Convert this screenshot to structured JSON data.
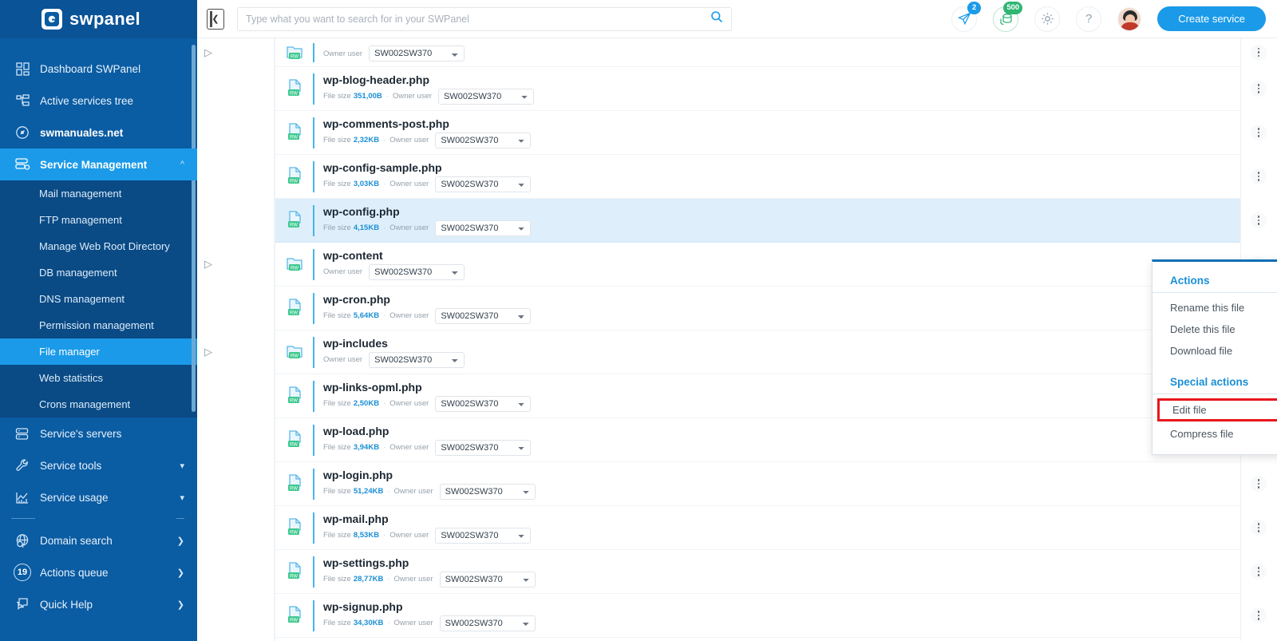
{
  "brand": {
    "name": "swpanel",
    "logo_icon": "swpanel-logo-icon"
  },
  "sidebar": {
    "items": [
      {
        "label": "Dashboard SWPanel",
        "icon": "grid-icon",
        "state": "normal",
        "chevron": ""
      },
      {
        "label": "Active services tree",
        "icon": "tree-icon",
        "state": "normal",
        "chevron": ""
      },
      {
        "label": "swmanuales.net",
        "icon": "domain-icon",
        "state": "bold",
        "chevron": ""
      },
      {
        "label": "Service Management",
        "icon": "server-gear-icon",
        "state": "active",
        "chevron": "chevron-up-icon"
      }
    ],
    "submenu": [
      {
        "label": "Mail management",
        "state": "normal"
      },
      {
        "label": "FTP management",
        "state": "normal"
      },
      {
        "label": "Manage Web Root Directory",
        "state": "normal"
      },
      {
        "label": "DB management",
        "state": "normal"
      },
      {
        "label": "DNS management",
        "state": "normal"
      },
      {
        "label": "Permission management",
        "state": "normal"
      },
      {
        "label": "File manager",
        "state": "active"
      },
      {
        "label": "Web statistics",
        "state": "normal"
      },
      {
        "label": "Crons management",
        "state": "normal"
      }
    ],
    "items_lower": [
      {
        "label": "Service's servers",
        "icon": "servers-icon",
        "chevron": ""
      },
      {
        "label": "Service tools",
        "icon": "wrench-icon",
        "chevron": "chevron-down-icon"
      },
      {
        "label": "Service usage",
        "icon": "chart-icon",
        "chevron": "chevron-down-icon"
      }
    ],
    "items_bottom": [
      {
        "label": "Domain search",
        "icon": "globe-search-icon",
        "badge": "",
        "chevron": "chevron-right-icon"
      },
      {
        "label": "Actions queue",
        "icon": "queue-count-icon",
        "badge": "19",
        "chevron": "chevron-right-icon"
      },
      {
        "label": "Quick Help",
        "icon": "chat-help-icon",
        "badge": "",
        "chevron": "chevron-right-icon"
      }
    ]
  },
  "topbar": {
    "collapse_icon": "collapse-panel-icon",
    "search": {
      "placeholder": "Type what you want to search for in your SWPanel",
      "value": ""
    },
    "search_icon": "search-icon",
    "icons": [
      {
        "name": "paper-plane-icon",
        "badge": "2",
        "badge_color": "#1a9ae8"
      },
      {
        "name": "database-icon",
        "badge": "500",
        "badge_color": "#2fb673"
      },
      {
        "name": "gear-icon",
        "badge": ""
      },
      {
        "name": "help-question-icon",
        "badge": ""
      }
    ],
    "avatar": "user-avatar",
    "create_button": "Create service"
  },
  "filelist": {
    "meta_size_label": "File size",
    "meta_owner_label": "Owner user",
    "owner_value": "SW002SW370",
    "owner_options": [
      "SW002SW370"
    ],
    "rows": [
      {
        "name": "",
        "type": "folder",
        "size": "",
        "owner": "SW002SW370",
        "expandable": true,
        "selected": false,
        "partial": true
      },
      {
        "name": "wp-blog-header.php",
        "type": "file",
        "size": "351,00B",
        "owner": "SW002SW370",
        "expandable": false,
        "selected": false
      },
      {
        "name": "wp-comments-post.php",
        "type": "file",
        "size": "2,32KB",
        "owner": "SW002SW370",
        "expandable": false,
        "selected": false
      },
      {
        "name": "wp-config-sample.php",
        "type": "file",
        "size": "3,03KB",
        "owner": "SW002SW370",
        "expandable": false,
        "selected": false
      },
      {
        "name": "wp-config.php",
        "type": "file",
        "size": "4,15KB",
        "owner": "SW002SW370",
        "expandable": false,
        "selected": true
      },
      {
        "name": "wp-content",
        "type": "folder",
        "size": "",
        "owner": "SW002SW370",
        "expandable": true,
        "selected": false
      },
      {
        "name": "wp-cron.php",
        "type": "file",
        "size": "5,64KB",
        "owner": "SW002SW370",
        "expandable": false,
        "selected": false
      },
      {
        "name": "wp-includes",
        "type": "folder",
        "size": "",
        "owner": "SW002SW370",
        "expandable": true,
        "selected": false
      },
      {
        "name": "wp-links-opml.php",
        "type": "file",
        "size": "2,50KB",
        "owner": "SW002SW370",
        "expandable": false,
        "selected": false
      },
      {
        "name": "wp-load.php",
        "type": "file",
        "size": "3,94KB",
        "owner": "SW002SW370",
        "expandable": false,
        "selected": false
      },
      {
        "name": "wp-login.php",
        "type": "file",
        "size": "51,24KB",
        "owner": "SW002SW370",
        "expandable": false,
        "selected": false
      },
      {
        "name": "wp-mail.php",
        "type": "file",
        "size": "8,53KB",
        "owner": "SW002SW370",
        "expandable": false,
        "selected": false
      },
      {
        "name": "wp-settings.php",
        "type": "file",
        "size": "28,77KB",
        "owner": "SW002SW370",
        "expandable": false,
        "selected": false
      },
      {
        "name": "wp-signup.php",
        "type": "file",
        "size": "34,30KB",
        "owner": "SW002SW370",
        "expandable": false,
        "selected": false
      }
    ]
  },
  "context_menu": {
    "close_icon": "close-icon",
    "actions_title": "Actions",
    "actions": [
      "Rename this file",
      "Delete this file",
      "Download file"
    ],
    "special_title": "Special actions",
    "special": [
      {
        "label": "Edit file",
        "highlighted": true
      },
      {
        "label": "Compress file",
        "highlighted": false
      }
    ]
  },
  "colors": {
    "brand_blue": "#0a5ca3",
    "accent_blue": "#1a9ae8",
    "selected_row": "#deeffb",
    "highlight_red": "#e8161b",
    "badge_green": "#2fb673"
  }
}
